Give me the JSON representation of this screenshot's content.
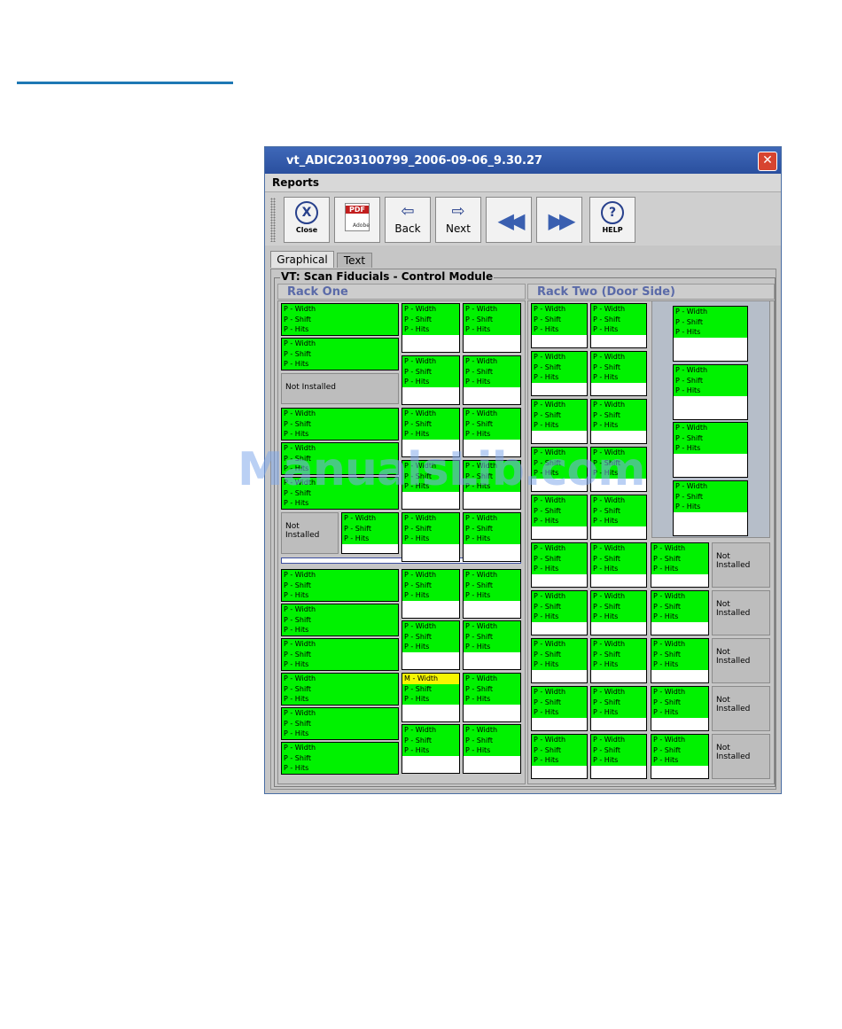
{
  "window": {
    "title": "vt_ADIC203100799_2006-09-06_9.30.27",
    "close_glyph": "✕",
    "menu": "Reports"
  },
  "toolbar": {
    "close_label": "Close",
    "pdf_label": "PDF",
    "pdf_sub": "Adobe",
    "back_label": "Back",
    "next_label": "Next",
    "help_label": "HELP"
  },
  "tabs": [
    "Graphical",
    "Text"
  ],
  "report": {
    "title": "VT: Scan Fiducials - Control Module",
    "rack_one": "Rack One",
    "rack_two": "Rack Two (Door Side)",
    "status_lines": [
      "P - Width",
      "P - Shift",
      "P - Hits"
    ],
    "status_lines_warn": [
      "M - Width",
      "P - Shift",
      "P - Hits"
    ],
    "not_installed": "Not Installed",
    "not_installed_2line": [
      "Not",
      "Installed"
    ]
  },
  "watermark": "ManualsLib.com",
  "colors": {
    "ok": "#00f200",
    "warn": "#f6f600",
    "accent": "#1e78b4"
  }
}
